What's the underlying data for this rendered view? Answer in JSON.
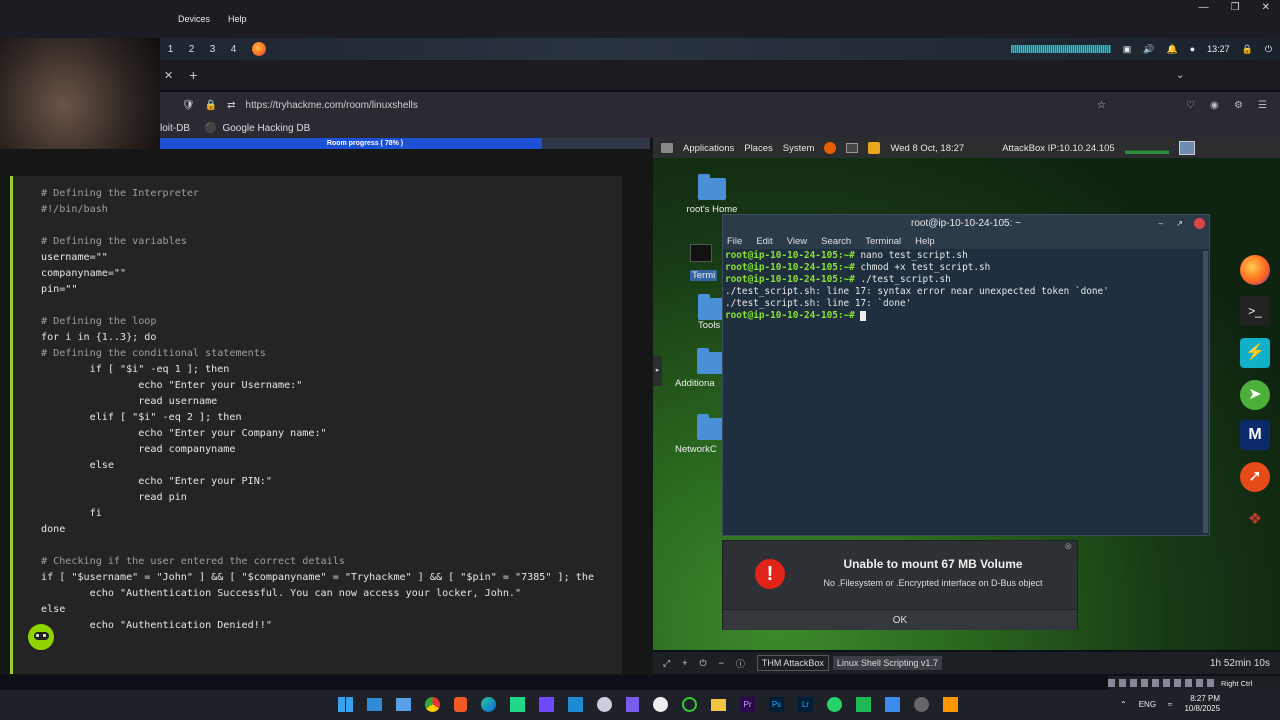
{
  "menubar": {
    "devices": "Devices",
    "help": "Help"
  },
  "workspaces": [
    "1",
    "2",
    "3",
    "4"
  ],
  "tray": {
    "time": "13:27"
  },
  "browser": {
    "new_tab": "+",
    "url": "https://tryhackme.com/room/linuxshells",
    "bookmarks": [
      "loit-DB",
      "Google Hacking DB"
    ]
  },
  "room": {
    "progress_label": "Room progress ( 78% )",
    "progress": 0.78
  },
  "code": {
    "lines": [
      "# Defining the Interpreter",
      "#!/bin/bash",
      "",
      "# Defining the variables",
      "username=\"\"",
      "companyname=\"\"",
      "pin=\"\"",
      "",
      "# Defining the loop",
      "for i in {1..3}; do",
      "# Defining the conditional statements",
      "        if [ \"$i\" -eq 1 ]; then",
      "                echo \"Enter your Username:\"",
      "                read username",
      "        elif [ \"$i\" -eq 2 ]; then",
      "                echo \"Enter your Company name:\"",
      "                read companyname",
      "        else",
      "                echo \"Enter your PIN:\"",
      "                read pin",
      "        fi",
      "done",
      "",
      "# Checking if the user entered the correct details",
      "if [ \"$username\" = \"John\" ] && [ \"$companyname\" = \"Tryhackme\" ] && [ \"$pin\" = \"7385\" ]; the",
      "        echo \"Authentication Successful. You can now access your locker, John.\"",
      "else",
      "        echo \"Authentication Denied!!\""
    ]
  },
  "attackbox": {
    "menu": [
      "Applications",
      "Places",
      "System"
    ],
    "datetime": "Wed 8 Oct, 18:27",
    "ip": "AttackBox IP:10.10.24.105"
  },
  "desktop_icons": [
    "root's Home",
    "Termi",
    "Tools",
    "Additiona",
    "NetworkC"
  ],
  "terminal": {
    "title": "root@ip-10-10-24-105: ~",
    "menu": [
      "File",
      "Edit",
      "View",
      "Search",
      "Terminal",
      "Help"
    ],
    "lines": [
      {
        "prompt": "root@ip-10-10-24-105:~#",
        "text": " nano test_script.sh"
      },
      {
        "prompt": "root@ip-10-10-24-105:~#",
        "text": " chmod +x test_script.sh"
      },
      {
        "prompt": "root@ip-10-10-24-105:~#",
        "text": " ./test_script.sh"
      },
      {
        "prompt": "",
        "text": "./test_script.sh: line 17: syntax error near unexpected token `done'"
      },
      {
        "prompt": "",
        "text": "./test_script.sh: line 17: `done'"
      },
      {
        "prompt": "root@ip-10-10-24-105:~#",
        "text": " "
      }
    ]
  },
  "dialog": {
    "title": "Unable to mount 67 MB Volume",
    "message": "No .Filesystem or .Encrypted interface on D-Bus object",
    "ok": "OK"
  },
  "statusbar": {
    "tab1": "THM AttackBox",
    "tab2": "Linux Shell Scripting v1.7",
    "timer": "1h 52min 10s"
  },
  "tray2": {
    "lang": "ENG",
    "time": "8:27 PM",
    "date": "10/8/2025",
    "right_ctrl": "Right Ctrl"
  }
}
